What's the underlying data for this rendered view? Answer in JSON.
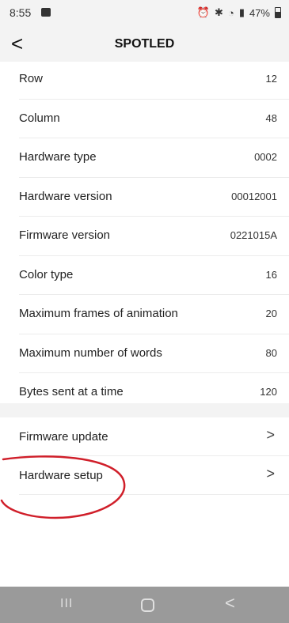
{
  "status": {
    "time": "8:55",
    "right": "47%"
  },
  "header": {
    "title": "SPOTLED",
    "back_symbol": "<"
  },
  "info_rows": [
    {
      "label": "Row",
      "value": "12"
    },
    {
      "label": "Column",
      "value": "48"
    },
    {
      "label": "Hardware type",
      "value": "0002"
    },
    {
      "label": "Hardware version",
      "value": "00012001"
    },
    {
      "label": "Firmware version",
      "value": "0221015A"
    },
    {
      "label": "Color type",
      "value": "16"
    },
    {
      "label": "Maximum frames of animation",
      "value": "20"
    },
    {
      "label": "Maximum number of words",
      "value": "80"
    },
    {
      "label": "Bytes sent at a time",
      "value": "120"
    }
  ],
  "action_rows": [
    {
      "label": "Firmware update",
      "chevron": ">"
    },
    {
      "label": "Hardware setup",
      "chevron": ">"
    }
  ],
  "annotation_color": "#d01f2a",
  "nav": {
    "recent": "III",
    "back": "<"
  }
}
